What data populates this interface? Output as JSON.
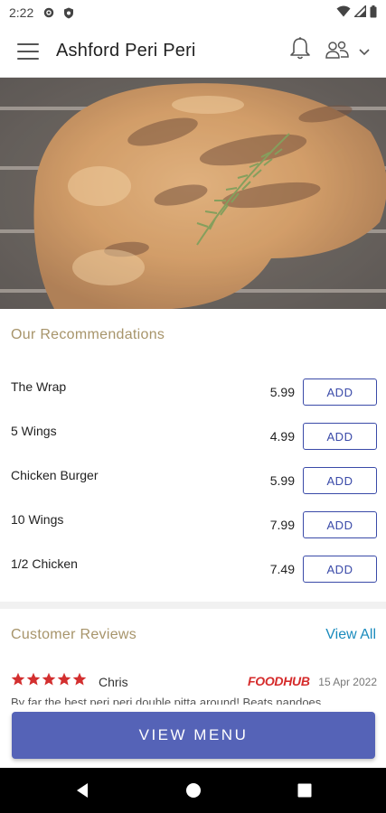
{
  "status": {
    "time": "2:22"
  },
  "app": {
    "title": "Ashford Peri Peri"
  },
  "recommendations": {
    "title": "Our Recommendations",
    "add_label": "ADD",
    "items": [
      {
        "name": "The Wrap",
        "price": "5.99"
      },
      {
        "name": "5 Wings",
        "price": "4.99"
      },
      {
        "name": "Chicken Burger",
        "price": "5.99"
      },
      {
        "name": "10 Wings",
        "price": "7.99"
      },
      {
        "name": "1/2 Chicken",
        "price": "7.49"
      }
    ]
  },
  "reviews": {
    "title": "Customer Reviews",
    "view_all": "View All",
    "items": [
      {
        "rating": 5,
        "reviewer": "Chris",
        "source": "FOODHUB",
        "date": "15 Apr 2022",
        "text": "By far the best peri peri double pitta around! Beats nandoes"
      }
    ]
  },
  "cta": {
    "view_menu": "VIEW MENU"
  },
  "colors": {
    "accent": "#5563b7",
    "add_border": "#3a4aa8",
    "section_title": "#a7946a",
    "link": "#1a8bbd",
    "star": "#d32f2f",
    "foodhub": "#d52b2b"
  },
  "icons": [
    "menu-icon",
    "bell-icon",
    "users-icon",
    "chevron-down-icon",
    "star-icon",
    "back-icon",
    "home-icon",
    "recents-icon"
  ]
}
